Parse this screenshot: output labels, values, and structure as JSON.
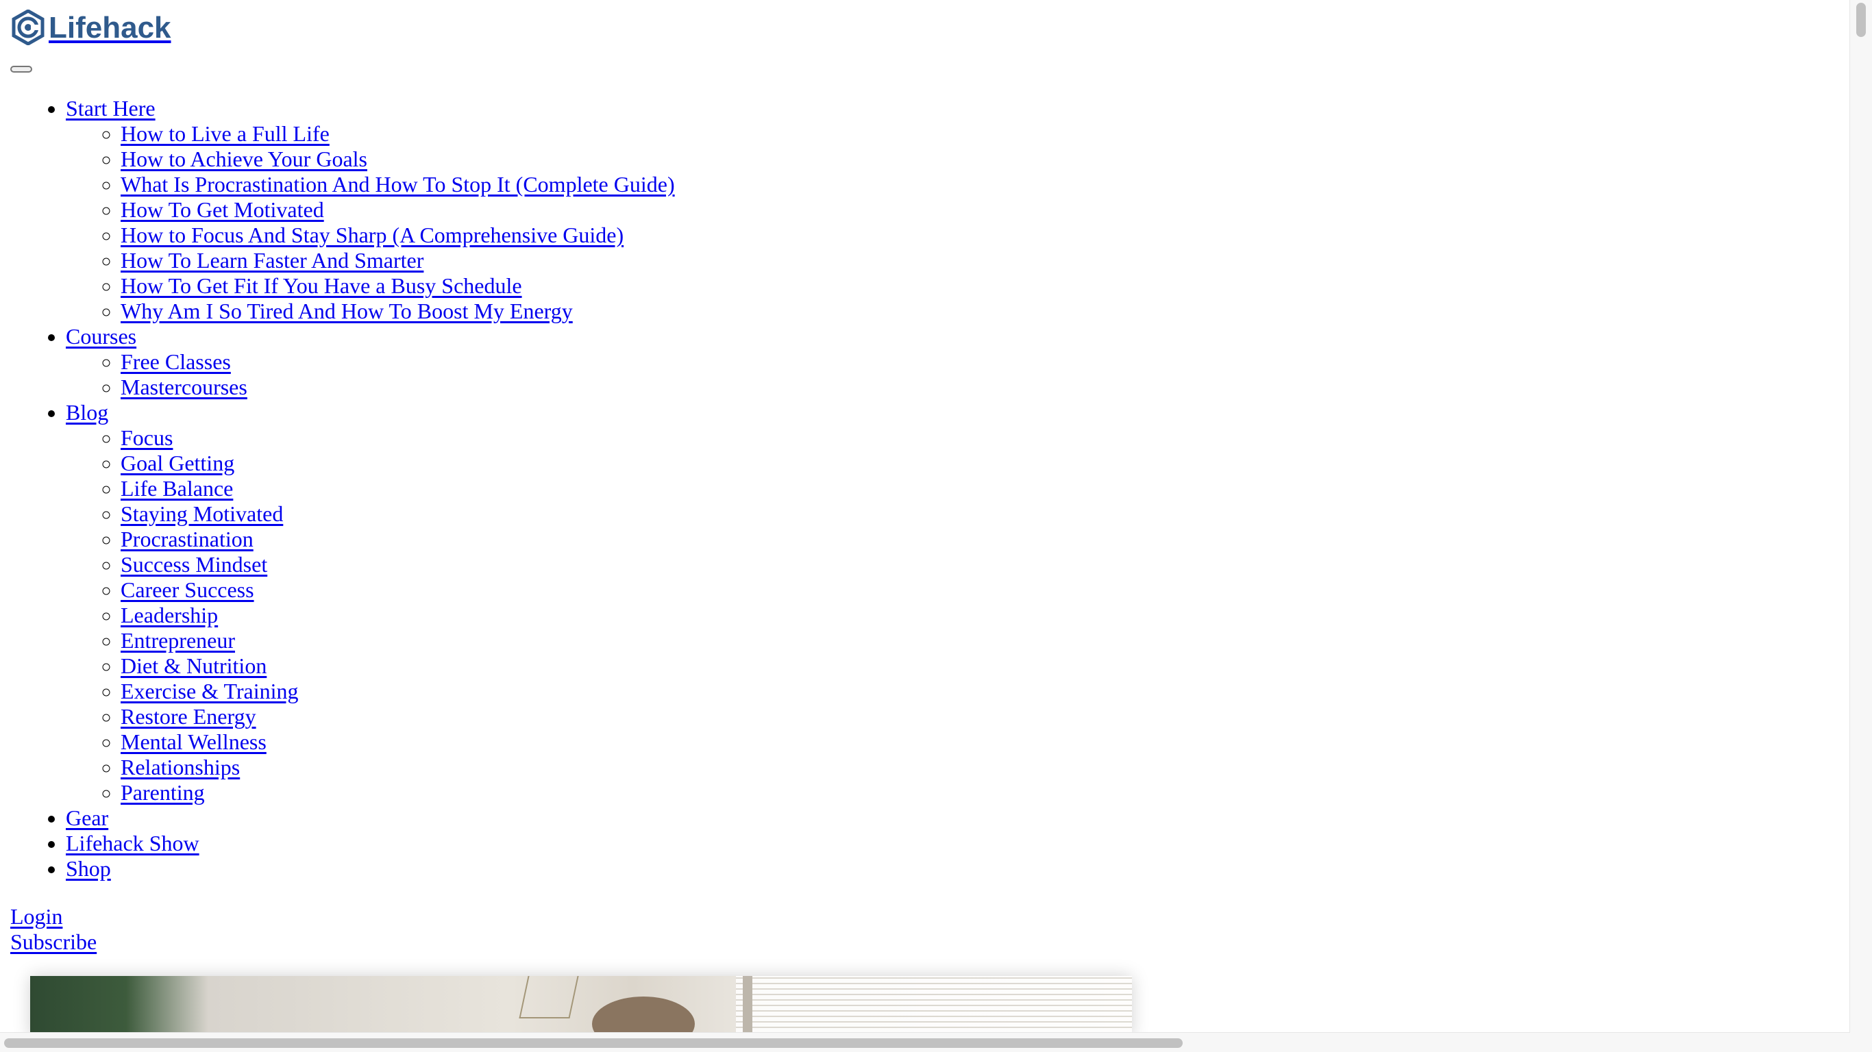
{
  "logo": {
    "text": "Lifehack",
    "color": "#2f5a8c",
    "icon": "lifehack-logo-icon"
  },
  "nav": [
    {
      "label": "Start Here",
      "children": [
        "How to Live a Full Life",
        "How to Achieve Your Goals",
        "What Is Procrastination And How To Stop It (Complete Guide)",
        "How To Get Motivated",
        "How to Focus And Stay Sharp (A Comprehensive Guide)",
        "How To Learn Faster And Smarter",
        "How To Get Fit If You Have a Busy Schedule",
        "Why Am I So Tired And How To Boost My Energy"
      ]
    },
    {
      "label": "Courses",
      "children": [
        "Free Classes",
        "Mastercourses"
      ]
    },
    {
      "label": "Blog",
      "children": [
        "Focus",
        "Goal Getting",
        "Life Balance",
        "Staying Motivated",
        "Procrastination",
        "Success Mindset",
        "Career Success",
        "Leadership",
        "Entrepreneur",
        "Diet & Nutrition",
        "Exercise & Training",
        "Restore Energy",
        "Mental Wellness",
        "Relationships",
        "Parenting"
      ]
    },
    {
      "label": "Gear",
      "children": []
    },
    {
      "label": "Lifehack Show",
      "children": []
    },
    {
      "label": "Shop",
      "children": []
    }
  ],
  "auth": {
    "login": "Login",
    "subscribe": "Subscribe"
  },
  "colors": {
    "link": "#0000ee",
    "brand": "#2f5a8c"
  }
}
